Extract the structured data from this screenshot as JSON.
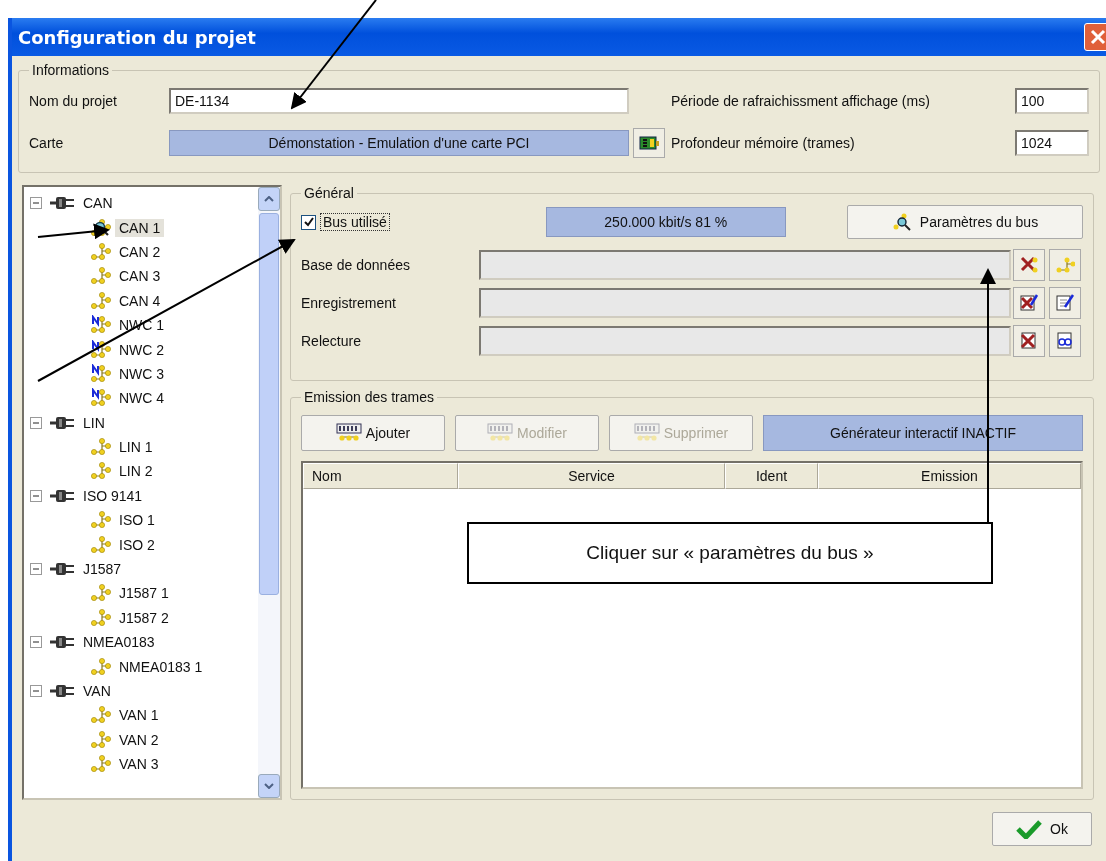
{
  "window": {
    "title": "Configuration du projet"
  },
  "informations": {
    "title": "Informations",
    "fields": [
      {
        "label": "Nom du projet",
        "value": "DE-1134",
        "kind": "input"
      },
      {
        "label": "Carte",
        "value": "Démonstation - Emulation d'une carte PCI",
        "kind": "display"
      }
    ],
    "settings": [
      {
        "label": "Période de rafraichissment affichage (ms)",
        "value": "100"
      },
      {
        "label": "Profondeur mémoire (trames)",
        "value": "1024"
      }
    ]
  },
  "tree": [
    {
      "label": "CAN",
      "kind": "bus",
      "expanded": true,
      "selected": false,
      "children": [
        {
          "label": "CAN 1",
          "kind": "channel",
          "selected": true
        },
        {
          "label": "CAN 2",
          "kind": "channel",
          "selected": false
        },
        {
          "label": "CAN 3",
          "kind": "channel",
          "selected": false
        },
        {
          "label": "CAN 4",
          "kind": "channel",
          "selected": false
        },
        {
          "label": "NWC 1",
          "kind": "nwc",
          "selected": false
        },
        {
          "label": "NWC 2",
          "kind": "nwc",
          "selected": false
        },
        {
          "label": "NWC 3",
          "kind": "nwc",
          "selected": false
        },
        {
          "label": "NWC 4",
          "kind": "nwc",
          "selected": false
        }
      ]
    },
    {
      "label": "LIN",
      "kind": "bus",
      "expanded": true,
      "selected": false,
      "children": [
        {
          "label": "LIN 1",
          "kind": "channel",
          "selected": false
        },
        {
          "label": "LIN 2",
          "kind": "channel",
          "selected": false
        }
      ]
    },
    {
      "label": "ISO 9141",
      "kind": "bus",
      "expanded": true,
      "selected": false,
      "children": [
        {
          "label": "ISO 1",
          "kind": "channel",
          "selected": false
        },
        {
          "label": "ISO 2",
          "kind": "channel",
          "selected": false
        }
      ]
    },
    {
      "label": "J1587",
      "kind": "bus",
      "expanded": true,
      "selected": false,
      "children": [
        {
          "label": "J1587 1",
          "kind": "channel",
          "selected": false
        },
        {
          "label": "J1587 2",
          "kind": "channel",
          "selected": false
        }
      ]
    },
    {
      "label": "NMEA0183",
      "kind": "bus",
      "expanded": true,
      "selected": false,
      "children": [
        {
          "label": "NMEA0183 1",
          "kind": "channel",
          "selected": false
        }
      ]
    },
    {
      "label": "VAN",
      "kind": "bus",
      "expanded": true,
      "selected": false,
      "children": [
        {
          "label": "VAN 1",
          "kind": "channel",
          "selected": false
        },
        {
          "label": "VAN 2",
          "kind": "channel",
          "selected": false
        },
        {
          "label": "VAN 3",
          "kind": "channel",
          "selected": false
        }
      ]
    }
  ],
  "general": {
    "title": "Général",
    "bus_used": {
      "label": "Bus utilisé",
      "checked": true
    },
    "rate": "250.000 kbit/s 81 %",
    "bus_params_button": "Paramètres du bus",
    "files": [
      {
        "label": "Base de données"
      },
      {
        "label": "Enregistrement"
      },
      {
        "label": "Relecture"
      }
    ]
  },
  "emission": {
    "title": "Emission des trames",
    "buttons": [
      {
        "label": "Ajouter",
        "disabled": false
      },
      {
        "label": "Modifier",
        "disabled": true
      },
      {
        "label": "Supprimer",
        "disabled": true
      }
    ],
    "generator": "Générateur interactif INACTIF",
    "table": {
      "columns": [
        "Nom",
        "Service",
        "Ident",
        "Emission"
      ]
    }
  },
  "ok_button": "Ok",
  "annotation": "Cliquer sur « paramètres du bus »"
}
